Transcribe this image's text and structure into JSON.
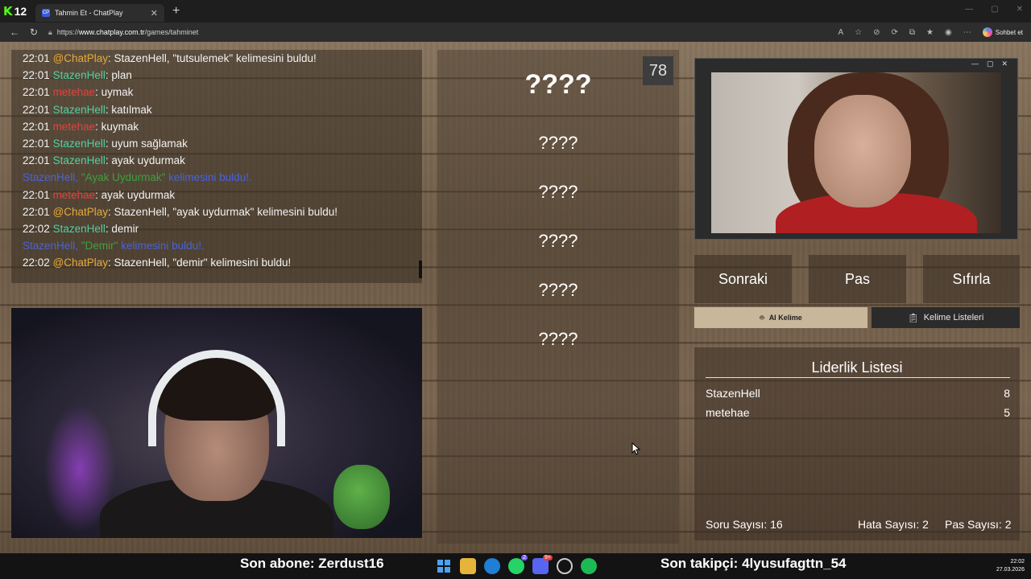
{
  "browser": {
    "kick_logo": "K",
    "kick_number": "12",
    "tab_title": "Tahmin Et - ChatPlay",
    "tab_favicon": "CP",
    "url_prefix": "https://",
    "url_host": "www.chatplay.com.tr",
    "url_path": "/games/tahminet",
    "chat_button": "Sohbet et"
  },
  "chat": [
    {
      "time": "22:01",
      "user": "@ChatPlay",
      "kind": "chatplay",
      "text": ": StazenHell, \"tutsulemek\" kelimesini buldu!"
    },
    {
      "time": "22:01",
      "user": "StazenHell",
      "kind": "stazen",
      "text": ": plan"
    },
    {
      "time": "22:01",
      "user": "metehae",
      "kind": "mete",
      "text": ": uymak"
    },
    {
      "time": "22:01",
      "user": "StazenHell",
      "kind": "stazen",
      "text": ": katılmak"
    },
    {
      "time": "22:01",
      "user": "metehae",
      "kind": "mete",
      "text": ": kuymak"
    },
    {
      "time": "22:01",
      "user": "StazenHell",
      "kind": "stazen",
      "text": ": uyum sağlamak"
    },
    {
      "time": "22:01",
      "user": "StazenHell",
      "kind": "stazen",
      "text": ": ayak uydurmak"
    },
    {
      "time": "",
      "user": "StazenHell, ",
      "kind": "sys",
      "hl": "\"Ayak Uydurmak\"",
      "text": " kelimesini buldu!."
    },
    {
      "time": "22:01",
      "user": "metehae",
      "kind": "mete",
      "text": ": ayak uydurmak"
    },
    {
      "time": "22:01",
      "user": "@ChatPlay",
      "kind": "chatplay",
      "text": ": StazenHell, \"ayak uydurmak\" kelimesini buldu!"
    },
    {
      "time": "22:02",
      "user": "StazenHell",
      "kind": "stazen",
      "text": ": demir"
    },
    {
      "time": "",
      "user": "StazenHell, ",
      "kind": "sys",
      "hl": "\"Demir\"",
      "text": " kelimesini buldu!."
    },
    {
      "time": "22:02",
      "user": "@ChatPlay",
      "kind": "chatplay",
      "text": ": StazenHell, \"demir\" kelimesini buldu!"
    }
  ],
  "game": {
    "counter": "78",
    "words": [
      "????",
      "????",
      "????",
      "????",
      "????",
      "????"
    ]
  },
  "controls": {
    "next": "Sonraki",
    "pass": "Pas",
    "reset": "Sıfırla",
    "ai_word": "AI Kelime",
    "word_lists": "Kelime Listeleri"
  },
  "leaderboard": {
    "title": "Liderlik Listesi",
    "rows": [
      {
        "name": "StazenHell",
        "score": "8"
      },
      {
        "name": "metehae",
        "score": "5"
      }
    ],
    "question_count": "Soru Sayısı: 16",
    "error_count": "Hata Sayısı: 2",
    "pass_count": "Pas Sayısı: 2"
  },
  "taskbar": {
    "last_sub": "Son abone: Zerdust16",
    "last_follow": "Son takipçi: 4lyusufagttn_54",
    "time": "22:02",
    "date": "27.03.2026",
    "whatsapp_badge": "2",
    "discord_badge": "9+"
  },
  "colors": {
    "stazen": "#4fd1a0",
    "metehae": "#e0443e",
    "chatplay": "#e6a93a",
    "system": "#4a63d8",
    "kick_green": "#53fc18"
  }
}
